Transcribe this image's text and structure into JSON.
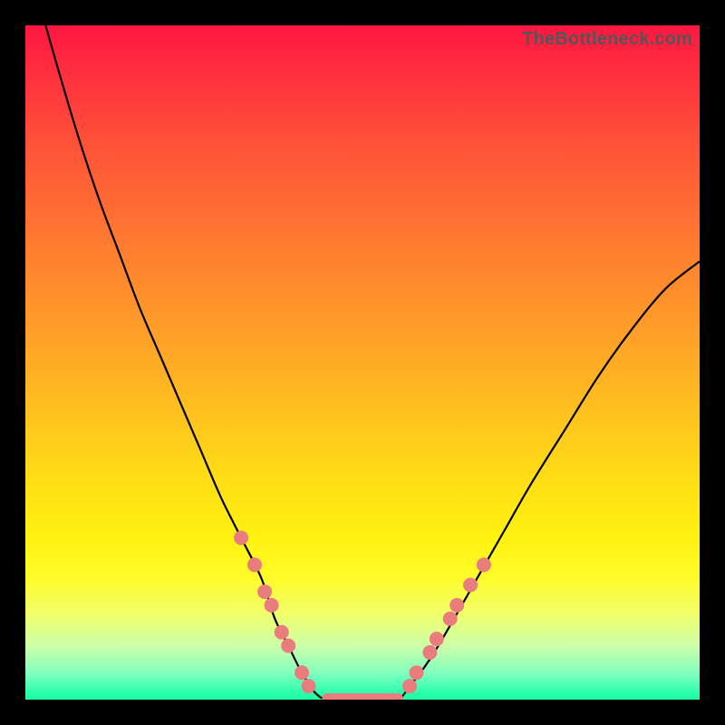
{
  "watermark": "TheBottleneck.com",
  "colors": {
    "frame": "#000000",
    "gradient_top": "#ff163f",
    "gradient_bottom": "#1bff9d",
    "curve": "#000000",
    "marker": "#e97c7c"
  },
  "chart_data": {
    "type": "line",
    "title": "",
    "xlabel": "",
    "ylabel": "",
    "xlim": [
      0,
      100
    ],
    "ylim": [
      0,
      100
    ],
    "grid": false,
    "note": "V-shaped bottleneck curve on a vertical green→red performance gradient; minimum plateau crosses green band; salmon markers cluster on both curve arms in the lower-yellow region around the trough",
    "series": [
      {
        "name": "bottleneck-curve",
        "x": [
          3,
          5,
          8,
          11,
          14,
          17,
          20,
          23,
          26,
          29,
          32,
          35,
          37,
          39,
          41,
          43,
          45,
          50,
          55,
          57,
          60,
          63,
          67,
          71,
          75,
          80,
          85,
          90,
          95,
          100
        ],
        "y": [
          100,
          93,
          83,
          74,
          66,
          58,
          51,
          44,
          37,
          30,
          24,
          18,
          12,
          8,
          4,
          1,
          0,
          0,
          0,
          2,
          6,
          11,
          18,
          25,
          32,
          40,
          48,
          55,
          61,
          65
        ]
      }
    ],
    "markers": {
      "left_arm": [
        {
          "x": 32,
          "y": 24
        },
        {
          "x": 34,
          "y": 20
        },
        {
          "x": 35.5,
          "y": 16
        },
        {
          "x": 36.5,
          "y": 14
        },
        {
          "x": 38,
          "y": 10
        },
        {
          "x": 39,
          "y": 8
        },
        {
          "x": 41,
          "y": 4
        },
        {
          "x": 42,
          "y": 2
        }
      ],
      "right_arm": [
        {
          "x": 57,
          "y": 2
        },
        {
          "x": 58,
          "y": 4
        },
        {
          "x": 60,
          "y": 7
        },
        {
          "x": 61,
          "y": 9
        },
        {
          "x": 63,
          "y": 12
        },
        {
          "x": 64,
          "y": 14
        },
        {
          "x": 66,
          "y": 17
        },
        {
          "x": 68,
          "y": 20
        }
      ],
      "flat_segment": {
        "x_start": 44,
        "x_end": 56,
        "y": 0
      }
    }
  }
}
